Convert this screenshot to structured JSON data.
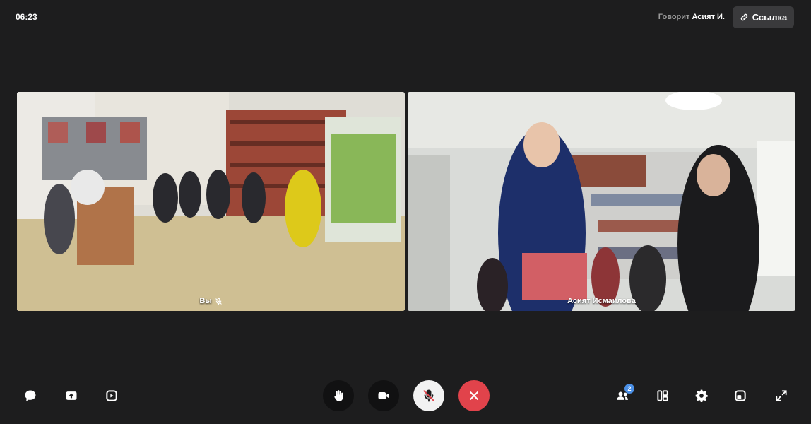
{
  "header": {
    "time": "06:23",
    "speaking_prefix": "Говорит",
    "speaking_name": "Асият И.",
    "link_label": "Ссылка",
    "link_icon": "link-icon"
  },
  "tiles": [
    {
      "label": "Вы",
      "mic_icon": "mic-off-icon"
    },
    {
      "label": "Асият Исмаилова"
    }
  ],
  "toolbar": {
    "left": [
      "chat-icon",
      "screen-share-icon",
      "record-icon"
    ],
    "center": [
      "raise-hand-icon",
      "camera-icon",
      "mic-off-icon",
      "end-call-icon"
    ],
    "right": [
      "participants-icon",
      "layout-icon",
      "settings-icon",
      "pip-icon",
      "fullscreen-icon"
    ],
    "participants_count": "2"
  },
  "colors": {
    "background": "#1d1d1e",
    "end_call": "#e1434b",
    "badge": "#4a8fe6"
  }
}
